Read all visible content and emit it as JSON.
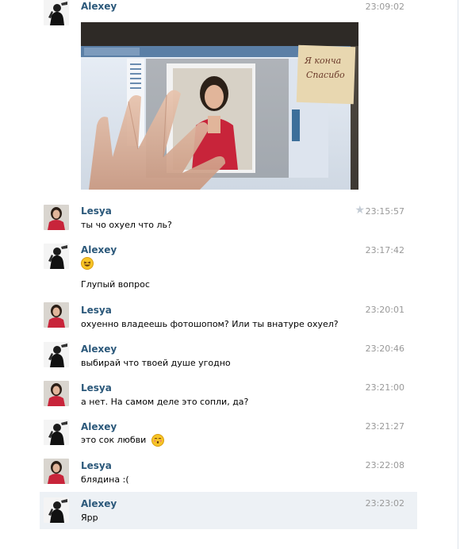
{
  "messages": [
    {
      "author": "Alexey",
      "time": "23:09:02",
      "text": "",
      "attachment": "photo"
    },
    {
      "author": "Lesya",
      "time": "23:15:57",
      "text": "ты чо охуел что ль?",
      "starred": true
    },
    {
      "author": "Alexey",
      "time": "23:17:42",
      "text": "Глупый вопрос",
      "emoji": "laughing-emoji"
    },
    {
      "author": "Lesya",
      "time": "23:20:01",
      "text": "охуенно владеешь фотошопом? Или ты внатуре охуел?"
    },
    {
      "author": "Alexey",
      "time": "23:20:46",
      "text": "выбирай что твоей душе угодно"
    },
    {
      "author": "Lesya",
      "time": "23:21:00",
      "text": "а нет. На самом деле это сопли, да?"
    },
    {
      "author": "Alexey",
      "time": "23:21:27",
      "text": "это сок любви",
      "emoji": "kissing-emoji"
    },
    {
      "author": "Lesya",
      "time": "23:22:08",
      "text": "блядина :("
    },
    {
      "author": "Alexey",
      "time": "23:23:02",
      "text": "Ярр",
      "highlighted": true
    }
  ],
  "photo": {
    "sticky_note_line1": "Я конча",
    "sticky_note_line2": "Спасибо"
  },
  "colors": {
    "author": "#2b587a",
    "time": "#999999",
    "highlight": "#edf1f5",
    "emoji": "#f7c526"
  }
}
